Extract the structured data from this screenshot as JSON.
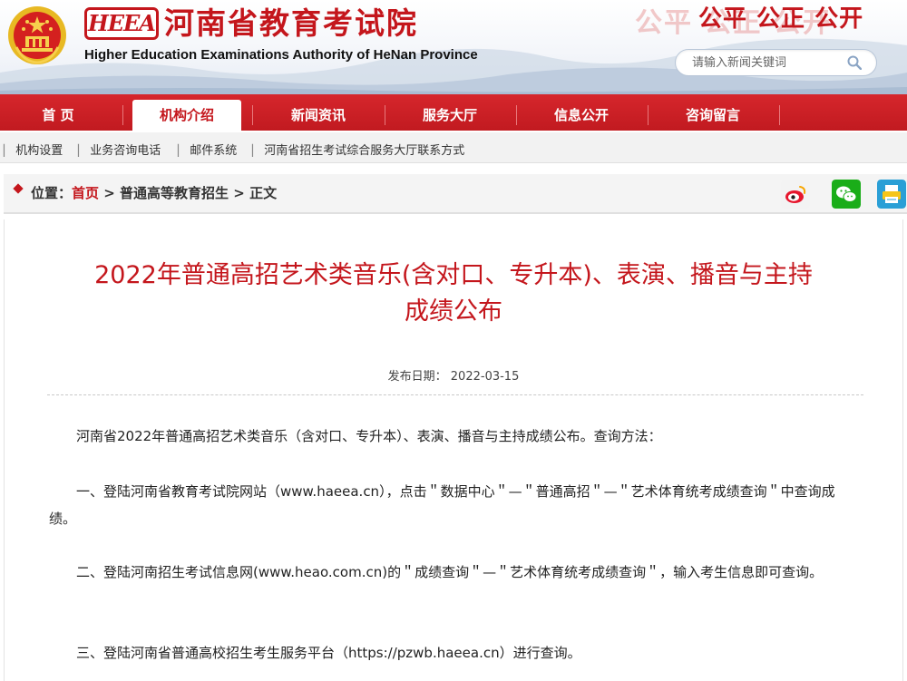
{
  "header": {
    "logo_text": "HEEA",
    "site_name_cn": "河南省教育考试院",
    "site_name_en": "Higher Education Examinations Authority of HeNan Province",
    "slogan": "公平 公正 公开",
    "search_placeholder": "请输入新闻关键词"
  },
  "nav": {
    "items": [
      {
        "label": "首 页"
      },
      {
        "label": "机构介绍"
      },
      {
        "label": "新闻资讯"
      },
      {
        "label": "服务大厅"
      },
      {
        "label": "信息公开"
      },
      {
        "label": "咨询留言"
      }
    ],
    "active_index": 1
  },
  "quicklinks": [
    {
      "label": "机构设置"
    },
    {
      "label": "业务咨询电话"
    },
    {
      "label": "邮件系统"
    },
    {
      "label": "河南省招生考试综合服务大厅联系方式"
    }
  ],
  "breadcrumb": {
    "prefix": "位置：",
    "home": "首页",
    "sep1": " > ",
    "section": "普通高等教育招生",
    "sep2": " > ",
    "current": "正文"
  },
  "share": [
    {
      "name": "weibo-icon",
      "color": "#e6162d"
    },
    {
      "name": "wechat-icon",
      "color": "#1aad19"
    },
    {
      "name": "print-icon",
      "color": "#2a9fd6"
    }
  ],
  "article": {
    "title_line1": "2022年普通高招艺术类音乐(含对口、专升本)、表演、播音与主持",
    "title_line2": "成绩公布",
    "pubdate": "发布日期： 2022-03-15",
    "paragraphs": [
      "河南省2022年普通高招艺术类音乐（含对口、专升本）、表演、播音与主持成绩公布。查询方法：",
      "一、登陆河南省教育考试院网站（www.haeea.cn），点击＂数据中心＂—＂普通高招＂—＂艺术体育统考成绩查询＂中查询成绩。",
      "二、登陆河南招生考试信息网(www.heao.com.cn)的＂成绩查询＂—＂艺术体育统考成绩查询＂，输入考生信息即可查询。",
      "三、登陆河南省普通高校招生考生服务平台（https://pzwb.haeea.cn）进行查询。"
    ]
  },
  "colors": {
    "brand_red": "#c4161c",
    "nav_red": "#d6262c"
  }
}
